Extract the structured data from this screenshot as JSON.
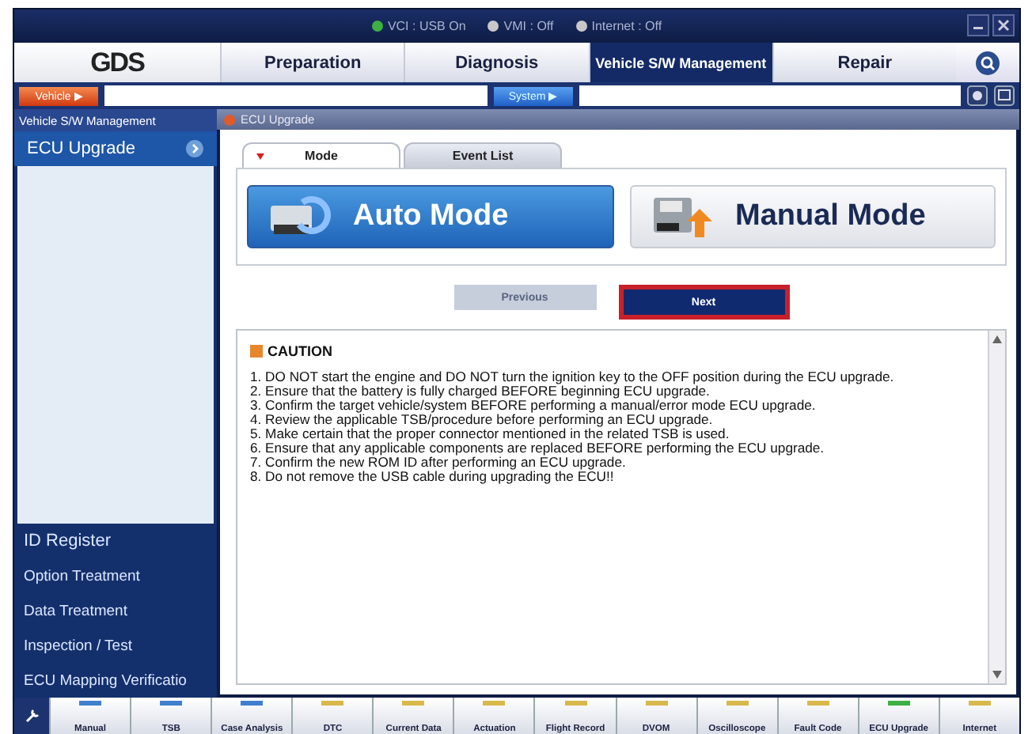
{
  "status_bar": [
    {
      "label": "VCI : USB On",
      "color": "#3cb043"
    },
    {
      "label": "VMI : Off",
      "color": "#c8c8c8"
    },
    {
      "label": "Internet : Off",
      "color": "#c8c8c8"
    }
  ],
  "logo": "GDS",
  "nav_tabs": [
    {
      "label": "Preparation",
      "selected": false
    },
    {
      "label": "Diagnosis",
      "selected": false
    },
    {
      "label": "Vehicle S/W Management",
      "selected": true
    },
    {
      "label": "Repair",
      "selected": false
    }
  ],
  "selector_bar": {
    "vehicle_button": "Vehicle ▶",
    "system_button": "System ▶"
  },
  "sidebar": {
    "title": "Vehicle S/W Management",
    "items": [
      {
        "label": "ECU Upgrade",
        "selected": true
      }
    ],
    "bottom_items": [
      {
        "label": "ID Register"
      },
      {
        "label": "Option Treatment"
      },
      {
        "label": "Data Treatment"
      },
      {
        "label": "Inspection / Test"
      },
      {
        "label": "ECU Mapping Verificatio"
      }
    ]
  },
  "breadcrumb": "ECU Upgrade",
  "tabs": [
    {
      "label": "Mode",
      "selected": true
    },
    {
      "label": "Event List",
      "selected": false
    }
  ],
  "modes": [
    {
      "label": "Auto Mode",
      "selected": true
    },
    {
      "label": "Manual Mode",
      "selected": false
    }
  ],
  "buttons": [
    {
      "label": "Previous",
      "disabled": true,
      "outlined": false
    },
    {
      "label": "Next",
      "disabled": false,
      "outlined": true
    }
  ],
  "caution": {
    "title": "CAUTION",
    "lines": [
      "1. DO NOT start the engine and DO NOT turn the ignition key to the OFF position during the ECU upgrade.",
      "2. Ensure that the battery is fully charged BEFORE beginning ECU upgrade.",
      "3. Confirm the target vehicle/system BEFORE performing a manual/error mode ECU upgrade.",
      "4. Review the applicable TSB/procedure before performing an ECU upgrade.",
      "5. Make certain that the proper connector mentioned in the related TSB is used.",
      "6. Ensure that any applicable components are replaced BEFORE performing the ECU upgrade.",
      "7. Confirm the new ROM ID after performing an ECU upgrade.",
      "8. Do not remove the USB cable during upgrading the ECU!!"
    ]
  },
  "toolbar": [
    {
      "label": "Manual",
      "color": "#3f7fd0"
    },
    {
      "label": "TSB",
      "color": "#3f7fd0"
    },
    {
      "label": "Case Analysis",
      "color": "#3f7fd0"
    },
    {
      "label": "DTC",
      "color": "#d8b84a"
    },
    {
      "label": "Current Data",
      "color": "#d8b84a"
    },
    {
      "label": "Actuation",
      "color": "#d8b84a"
    },
    {
      "label": "Flight Record",
      "color": "#d8b84a"
    },
    {
      "label": "DVOM",
      "color": "#d8b84a"
    },
    {
      "label": "Oscilloscope",
      "color": "#d8b84a"
    },
    {
      "label": "Fault Code",
      "color": "#d8b84a"
    },
    {
      "label": "ECU Upgrade",
      "color": "#3cb043"
    },
    {
      "label": "Internet",
      "color": "#d8b84a"
    }
  ]
}
